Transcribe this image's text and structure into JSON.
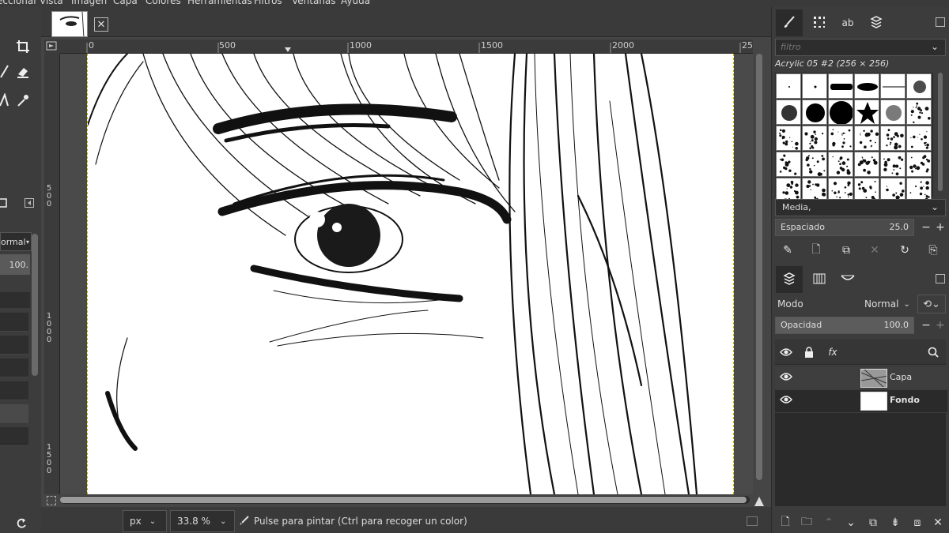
{
  "menubar": {
    "items": [
      "eccionar",
      "Vista",
      "Imagen",
      "Capa",
      "Colores",
      "Herramientas",
      "Filtros",
      "Ventanas",
      "Ayuda"
    ]
  },
  "toolbox": {
    "mode_label": "ormal",
    "opacity_value": "100."
  },
  "rulers": {
    "top": [
      "0",
      "500",
      "1000",
      "1500",
      "2000",
      "250"
    ],
    "left": [
      "5\n0\n0",
      "1\n0\n0\n0",
      "1\n5\n0\n0"
    ]
  },
  "statusbar": {
    "unit": "px",
    "zoom": "33.8 %",
    "message": "Pulse para pintar (Ctrl para recoger un color)"
  },
  "brushes": {
    "filter_placeholder": "filtro",
    "selected_title": "Acrylic 05 #2 (256 × 256)",
    "category": "Media,",
    "spacing_label": "Espaciado",
    "spacing_value": "25.0"
  },
  "layers": {
    "mode_label": "Modo",
    "mode_value": "Normal",
    "opacity_label": "Opacidad",
    "opacity_value": "100.0",
    "items": [
      {
        "name": "Capa",
        "bold": false
      },
      {
        "name": "Fondo",
        "bold": true
      }
    ]
  },
  "icons": [
    "paintbrush-icon",
    "pattern-icon",
    "font-icon",
    "document-history-icon",
    "layers-icon",
    "channels-icon",
    "paths-icon",
    "eye-icon",
    "lock-icon",
    "fx-icon",
    "search-icon"
  ],
  "colors": {
    "accent": "#c8b400",
    "panel": "#3c3c3c",
    "dark": "#2d2d2d"
  }
}
